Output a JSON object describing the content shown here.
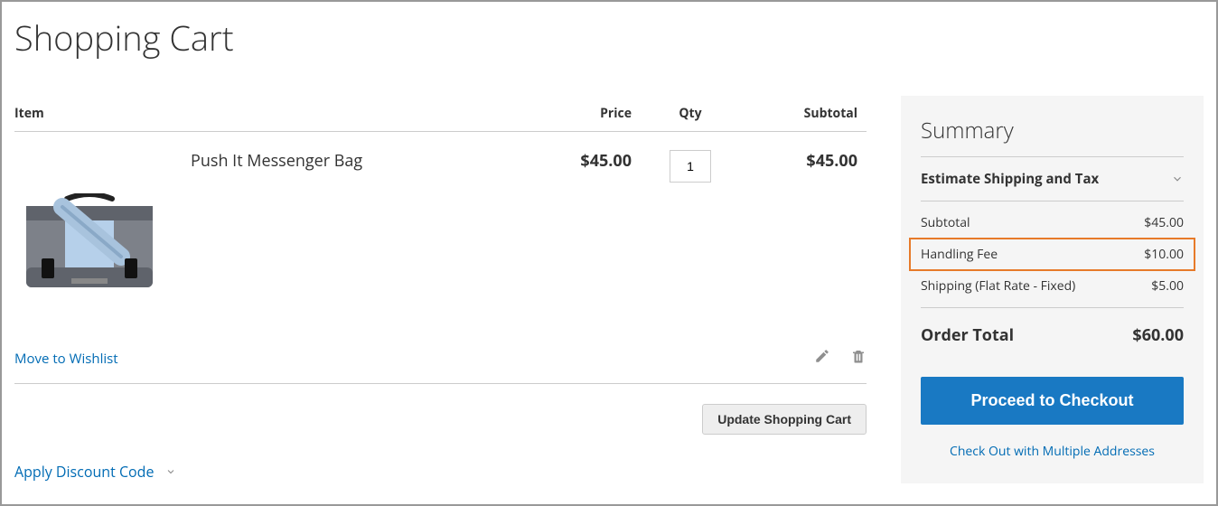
{
  "page": {
    "title": "Shopping Cart"
  },
  "cart": {
    "headers": {
      "item": "Item",
      "price": "Price",
      "qty": "Qty",
      "subtotal": "Subtotal"
    },
    "items": [
      {
        "name": "Push It Messenger Bag",
        "price": "$45.00",
        "qty": "1",
        "subtotal": "$45.00"
      }
    ],
    "move_to_wishlist": "Move to Wishlist",
    "update_button": "Update Shopping Cart",
    "discount_link": "Apply Discount Code"
  },
  "summary": {
    "title": "Summary",
    "estimate_label": "Estimate Shipping and Tax",
    "rows": [
      {
        "label": "Subtotal",
        "value": "$45.00"
      },
      {
        "label": "Handling Fee",
        "value": "$10.00"
      },
      {
        "label": "Shipping (Flat Rate - Fixed)",
        "value": "$5.00"
      }
    ],
    "order_total_label": "Order Total",
    "order_total_value": "$60.00",
    "checkout_button": "Proceed to Checkout",
    "multi_address_link": "Check Out with Multiple Addresses"
  }
}
